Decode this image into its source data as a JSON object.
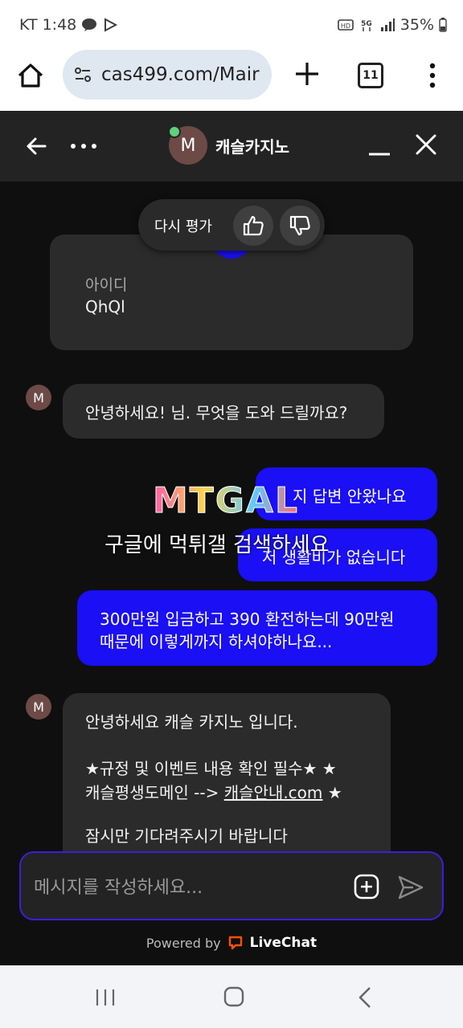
{
  "status_bar": {
    "carrier": "KT",
    "time": "1:48",
    "battery": "35%",
    "icons": [
      "kakaotalk-icon",
      "play-icon",
      "hd-icon",
      "5g-icon",
      "signal-icon",
      "battery-icon"
    ]
  },
  "browser": {
    "url": "cas499.com/Mair",
    "tab_count": "11"
  },
  "chat_header": {
    "agent_initial": "M",
    "agent_name": "캐슬카지노"
  },
  "rating": {
    "label": "다시 평가"
  },
  "messages": {
    "form_field_label": "아이디",
    "form_field_value": "QhQl",
    "greeting": "안녕하세요! 님. 무엇을 도와 드릴까요?",
    "user_1": "지 답변 안왔나요",
    "user_2": "저 생활비가 없습니다",
    "user_3_line1": "300만원 입금하고 390 환전하는데 90만원",
    "user_3_line2": "때문에 이렇게까지 하셔야하나요...",
    "agent_2_line1": "안녕하세요 캐슬 카지노 입니다.",
    "agent_2_line2": "★규정 및 이벤트 내용 확인 필수★ ★",
    "agent_2_line3_pre": "캐슬평생도메인 --> ",
    "agent_2_link": "캐슬안내.com",
    "agent_2_line3_post": " ★",
    "agent_2_line4": "잠시만 기다려주시기 바랍니다",
    "avatar_initial": "M"
  },
  "watermark": {
    "logo": "MTGAL",
    "text": "구글에 먹튀갤 검색하세요"
  },
  "composer": {
    "placeholder": "메시지를 작성하세요..."
  },
  "footer": {
    "powered_by": "Powered by",
    "brand": "LiveChat"
  },
  "colors": {
    "accent": "#1a0ff5",
    "background": "#0f0f0f",
    "bubble_in": "#2b2b2b",
    "header": "#232323"
  }
}
